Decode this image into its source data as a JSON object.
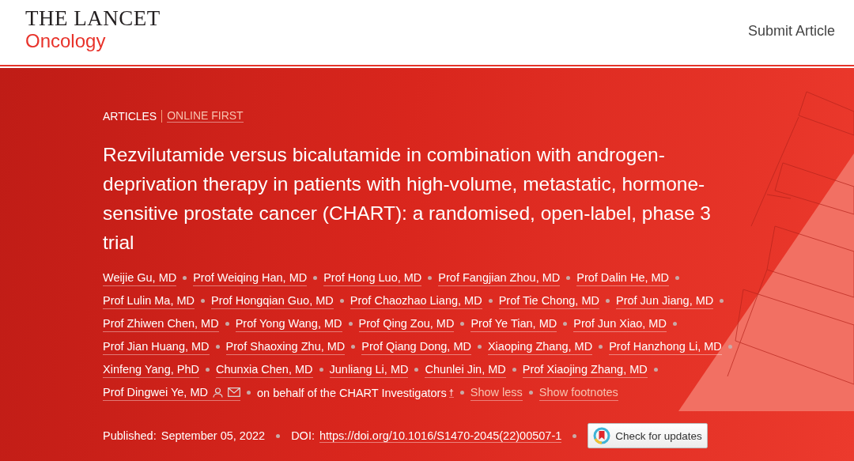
{
  "header": {
    "journal": "THE LANCET",
    "subtitle": "Oncology",
    "submit": "Submit Article"
  },
  "article": {
    "type": "ARTICLES",
    "section": "ONLINE FIRST",
    "title": "Rezvilutamide versus bicalutamide in combination with androgen-deprivation therapy in patients with high-volume, metastatic, hormone-sensitive prostate cancer (CHART): a randomised, open-label, phase 3 trial",
    "authors": [
      {
        "name": "Weijie Gu, MD",
        "corresponding": false
      },
      {
        "name": "Prof Weiqing Han, MD",
        "corresponding": false
      },
      {
        "name": "Prof Hong Luo, MD",
        "corresponding": false
      },
      {
        "name": "Prof Fangjian Zhou, MD",
        "corresponding": false
      },
      {
        "name": "Prof Dalin He, MD",
        "corresponding": false
      },
      {
        "name": "Prof Lulin Ma, MD",
        "corresponding": false
      },
      {
        "name": "Prof Hongqian Guo, MD",
        "corresponding": false
      },
      {
        "name": "Prof Chaozhao Liang, MD",
        "corresponding": false
      },
      {
        "name": "Prof Tie Chong, MD",
        "corresponding": false
      },
      {
        "name": "Prof Jun Jiang, MD",
        "corresponding": false
      },
      {
        "name": "Prof Zhiwen Chen, MD",
        "corresponding": false
      },
      {
        "name": "Prof Yong Wang, MD",
        "corresponding": false
      },
      {
        "name": "Prof Qing Zou, MD",
        "corresponding": false
      },
      {
        "name": "Prof Ye Tian, MD",
        "corresponding": false
      },
      {
        "name": "Prof Jun Xiao, MD",
        "corresponding": false
      },
      {
        "name": "Prof Jian Huang, MD",
        "corresponding": false
      },
      {
        "name": "Prof Shaoxing Zhu, MD",
        "corresponding": false
      },
      {
        "name": "Prof Qiang Dong, MD",
        "corresponding": false
      },
      {
        "name": "Xiaoping Zhang, MD",
        "corresponding": false
      },
      {
        "name": "Prof Hanzhong Li, MD",
        "corresponding": false
      },
      {
        "name": "Xinfeng Yang, PhD",
        "corresponding": false
      },
      {
        "name": "Chunxia Chen, MD",
        "corresponding": false
      },
      {
        "name": "Junliang Li, MD",
        "corresponding": false
      },
      {
        "name": "Chunlei Jin, MD",
        "corresponding": false
      },
      {
        "name": "Prof Xiaojing Zhang, MD",
        "corresponding": false
      },
      {
        "name": "Prof Dingwei Ye, MD",
        "corresponding": true
      }
    ],
    "group": "on behalf of the CHART Investigators",
    "group_footnote": "†",
    "links": [
      "Show less",
      "Show footnotes"
    ],
    "published_label": "Published:",
    "published_date": "September 05, 2022",
    "doi_label": "DOI:",
    "doi": "https://doi.org/10.1016/S1470-2045(22)00507-1",
    "updates_button": "Check for updates"
  }
}
